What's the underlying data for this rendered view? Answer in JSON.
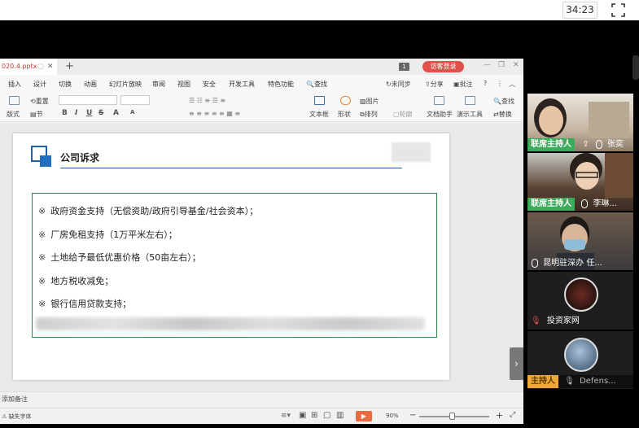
{
  "meeting": {
    "timer": "34:23",
    "fullscreen_icon": "fullscreen-icon"
  },
  "wps": {
    "doc_tab": "020.4.pptx",
    "new_tab": "+",
    "tab_count": "1",
    "login": "访客登录",
    "menus": [
      "插入",
      "设计",
      "切换",
      "动画",
      "幻灯片放映",
      "审阅",
      "视图",
      "安全",
      "开发工具",
      "特色功能"
    ],
    "search": "查找",
    "right_menus": [
      "未同步",
      "分享",
      "批注"
    ],
    "ribbon": {
      "reset": "重置",
      "layout": "版式",
      "section": "节",
      "picture": "图片",
      "textbox": "文本框",
      "shape": "形状",
      "arrange": "排列",
      "outline": "轮廓",
      "doc_helper": "文档助手",
      "present_tool": "演示工具",
      "find": "查找",
      "replace": "替换",
      "format_buttons": [
        "B",
        "I",
        "U",
        "S",
        "A",
        "A"
      ]
    },
    "slide": {
      "title": "公司诉求",
      "bullets": [
        "政府资金支持（无偿资助/政府引导基金/社会资本）；",
        "厂房免租支持（1万平米左右）；",
        "土地给予最低优惠价格（50亩左右）；",
        "地方税收减免；",
        "银行信用贷款支持；"
      ]
    },
    "notes_placeholder": "添加备注",
    "status": {
      "font_missing": "缺失字体",
      "zoom": "90%"
    }
  },
  "participants": [
    {
      "badge": "联席主持人",
      "name": "张奕",
      "icon": "screen-share-icon"
    },
    {
      "badge": "联席主持人",
      "name": "李琳...",
      "icon": "mic-icon"
    },
    {
      "badge": "",
      "name": "昆明驻深办 任...",
      "icon": "mic-icon"
    },
    {
      "badge": "",
      "name": "投资家网",
      "icon": "mic-muted-icon"
    },
    {
      "badge": "主持人",
      "name": "Defens...",
      "icon": "mic-muted-icon"
    }
  ],
  "colors": {
    "host_green": "#3daa5c",
    "login_red": "#e2504b",
    "slide_border_green": "#2f8a4a",
    "accent_blue": "#1f5fa6"
  }
}
